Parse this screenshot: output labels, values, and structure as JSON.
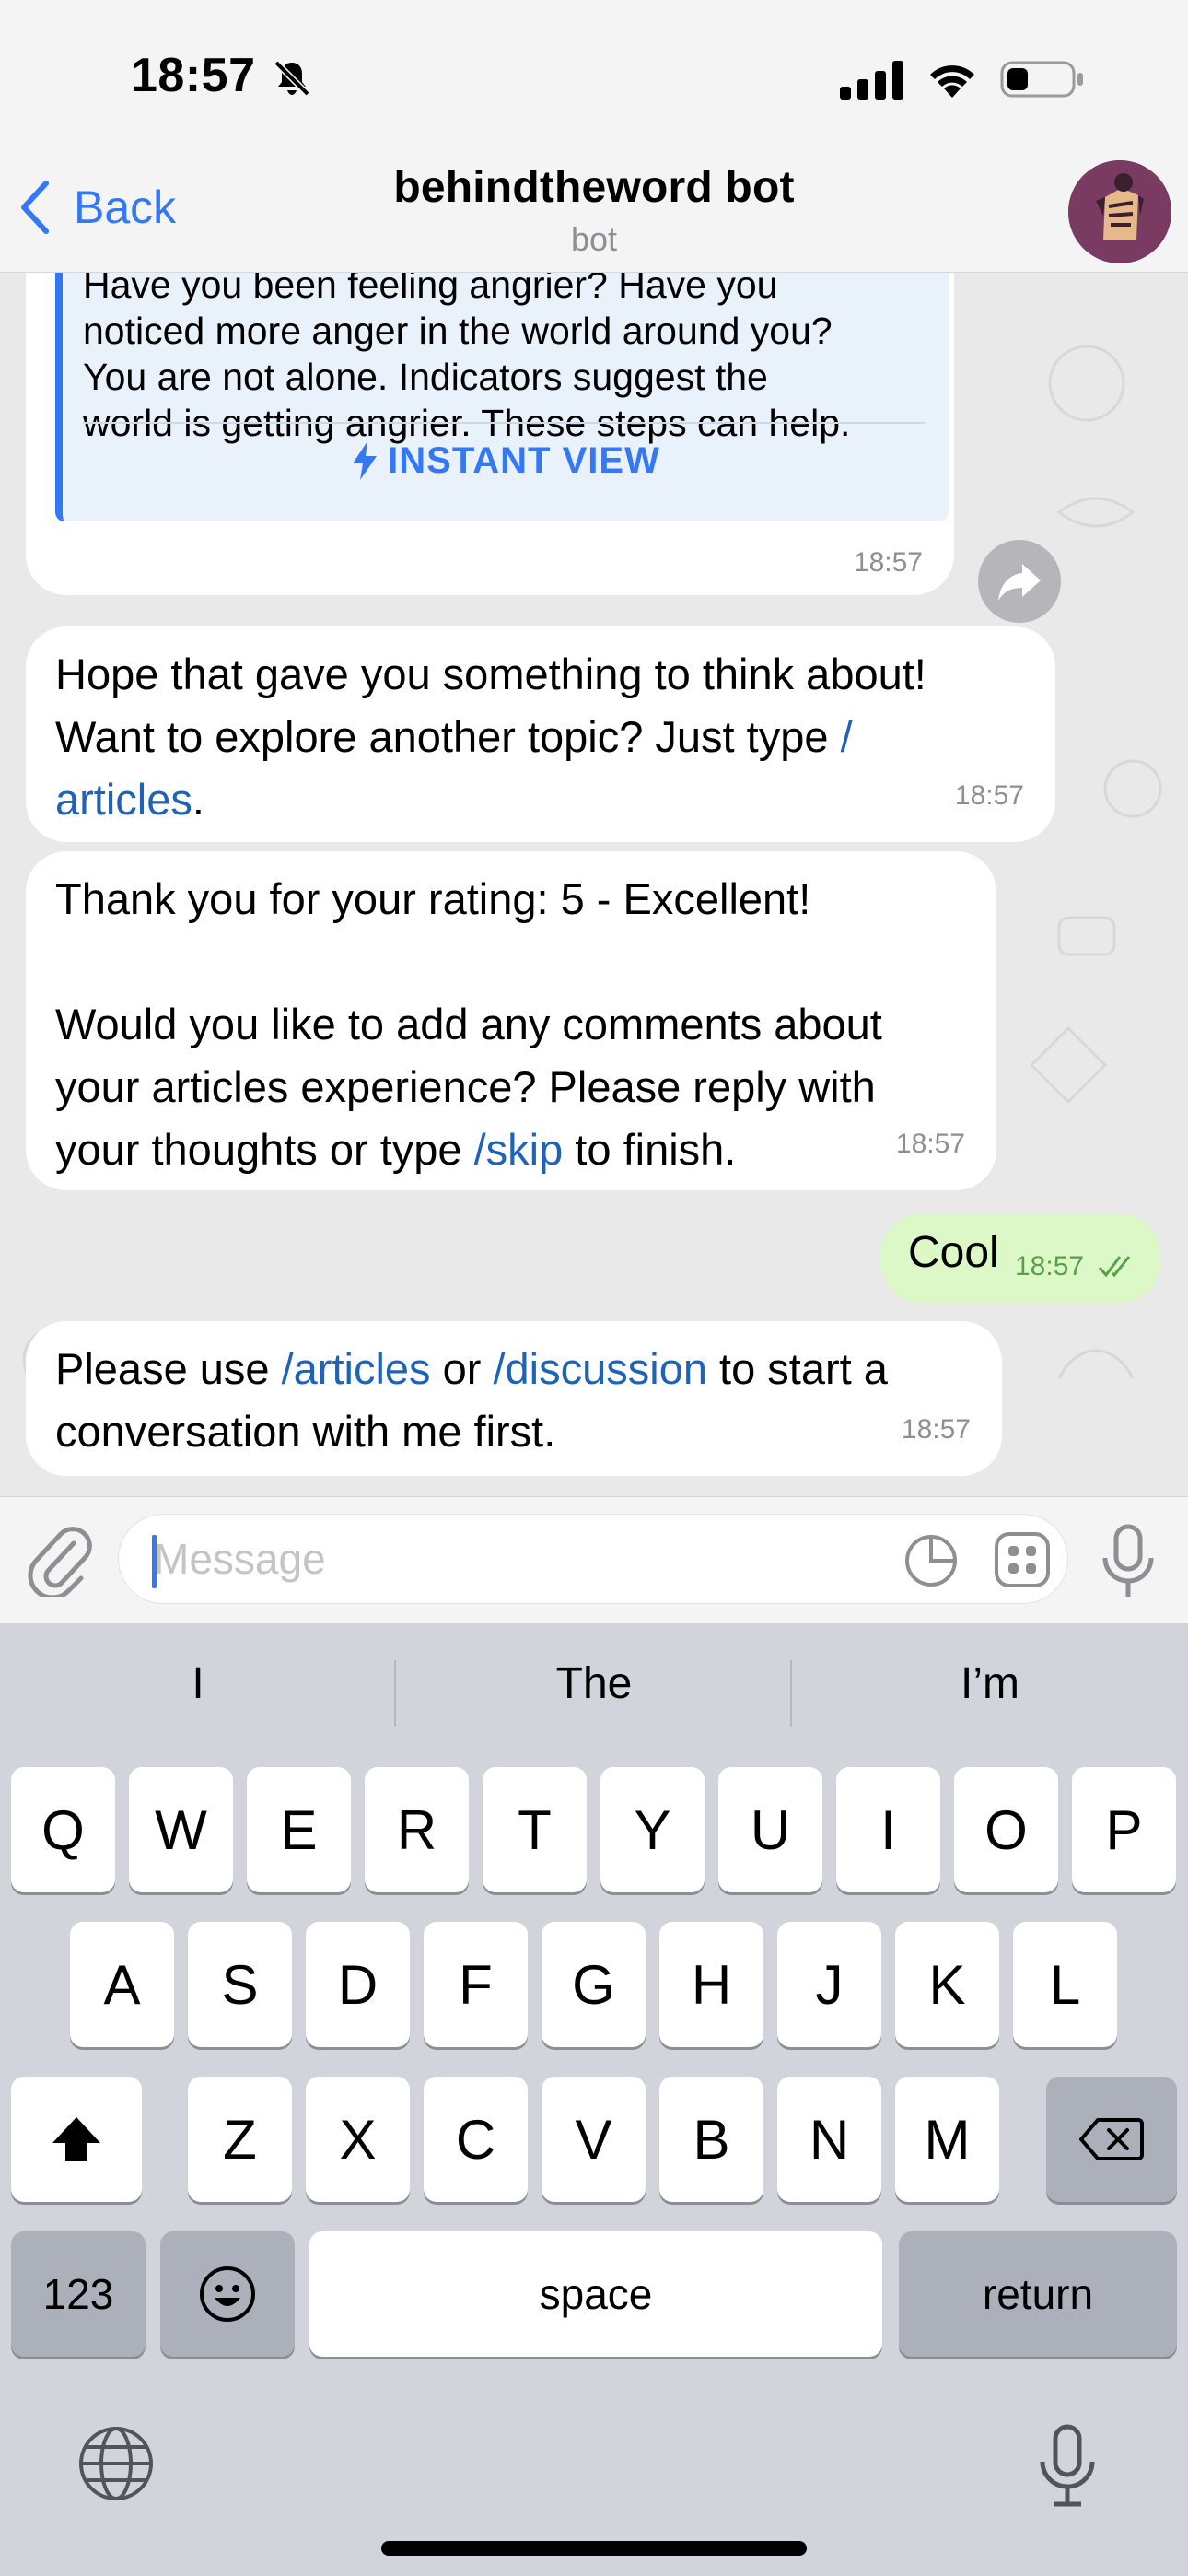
{
  "status_bar": {
    "time": "18:57"
  },
  "header": {
    "back_label": "Back",
    "title": "behindtheword bot",
    "subtitle": "bot"
  },
  "messages": {
    "preview": {
      "line1": "Have you been feeling angrier? Have you",
      "line2": "noticed more anger in the world around you?",
      "line3": "You are not alone. Indicators suggest the",
      "line4": "world is getting angrier. These steps can help.",
      "instant_view": "INSTANT VIEW",
      "time": "18:57"
    },
    "m1": {
      "text_a": "Hope that gave you something to think about!",
      "text_b": "Want to explore another topic? Just type ",
      "link_a": "/",
      "link_b": "articles",
      "text_c": ".",
      "time": "18:57"
    },
    "m2": {
      "line1": "Thank you for your rating: 5 - Excellent!",
      "line2": "Would you like to add any comments about",
      "line3": "your articles experience? Please reply with",
      "line4a": "your thoughts or type ",
      "link": "/skip",
      "line4b": " to finish.",
      "time": "18:57"
    },
    "out": {
      "text": "Cool",
      "time": "18:57"
    },
    "m3": {
      "text_a": "Please use ",
      "link1": "/articles",
      "text_b": " or ",
      "link2": "/discussion",
      "text_c": " to start a",
      "line2": "conversation with me first.",
      "time": "18:57"
    }
  },
  "composer": {
    "placeholder": "Message"
  },
  "keyboard": {
    "suggestions": [
      "I",
      "The",
      "I’m"
    ],
    "row1": [
      "Q",
      "W",
      "E",
      "R",
      "T",
      "Y",
      "U",
      "I",
      "O",
      "P"
    ],
    "row2": [
      "A",
      "S",
      "D",
      "F",
      "G",
      "H",
      "J",
      "K",
      "L"
    ],
    "row3": [
      "Z",
      "X",
      "C",
      "V",
      "B",
      "N",
      "M"
    ],
    "numbers_label": "123",
    "space_label": "space",
    "return_label": "return"
  },
  "colors": {
    "accent": "#3478f6",
    "link": "#1f63b9",
    "outgoing": "#dcf8c6"
  }
}
